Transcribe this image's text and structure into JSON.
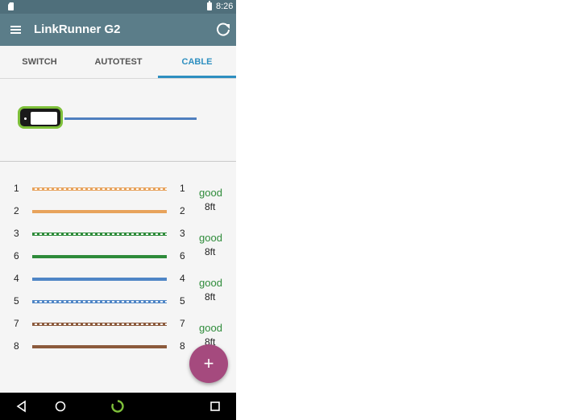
{
  "status_bar": {
    "time": "8:26"
  },
  "app_bar": {
    "title": "LinkRunner G2",
    "menu_icon": "menu-icon",
    "refresh_icon": "refresh-icon"
  },
  "tabs": [
    {
      "label": "SWITCH",
      "active": false
    },
    {
      "label": "AUTOTEST",
      "active": false
    },
    {
      "label": "CABLE",
      "active": true
    }
  ],
  "colors": {
    "status_bar": "#4f6f7b",
    "app_bar": "#5b7d89",
    "accent": "#2e8fc0",
    "cable_line": "#4f7fbf",
    "device_border": "#7ec03a",
    "good": "#2e8b3a",
    "fab": "#a54a7e"
  },
  "wires": [
    {
      "left_pin": "1",
      "right_pin": "1",
      "color": "#e8a35c",
      "striped": true
    },
    {
      "left_pin": "2",
      "right_pin": "2",
      "color": "#e8a35c",
      "striped": false
    },
    {
      "left_pin": "3",
      "right_pin": "3",
      "color": "#2e8b3a",
      "striped": true
    },
    {
      "left_pin": "6",
      "right_pin": "6",
      "color": "#2e8b3a",
      "striped": false
    },
    {
      "left_pin": "4",
      "right_pin": "4",
      "color": "#4f86c6",
      "striped": false
    },
    {
      "left_pin": "5",
      "right_pin": "5",
      "color": "#4f86c6",
      "striped": true
    },
    {
      "left_pin": "7",
      "right_pin": "7",
      "color": "#8b5a3c",
      "striped": true
    },
    {
      "left_pin": "8",
      "right_pin": "8",
      "color": "#8b5a3c",
      "striped": false
    }
  ],
  "pairs": [
    {
      "status": "good",
      "length": "8ft"
    },
    {
      "status": "good",
      "length": "8ft"
    },
    {
      "status": "good",
      "length": "8ft"
    },
    {
      "status": "good",
      "length": "8ft"
    }
  ],
  "fab": {
    "label": "+",
    "icon": "plus-icon"
  },
  "nav_bar": {
    "back_icon": "back-icon",
    "home_icon": "home-icon",
    "assistant_icon": "assistant-icon",
    "recents_icon": "recents-icon"
  }
}
